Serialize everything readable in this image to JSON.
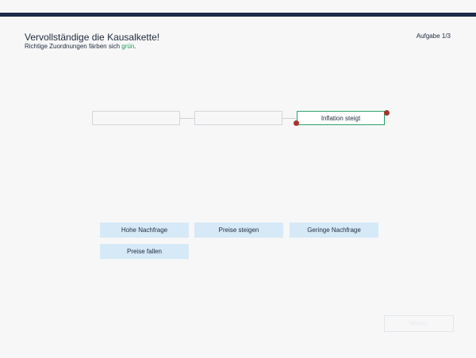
{
  "header": {
    "title": "Vervollständige die Kausalkette!",
    "subtitle_prefix": "Richtige Zuordnungen färben sich ",
    "subtitle_highlight": "grün",
    "subtitle_suffix": ".",
    "task_counter": "Aufgabe 1/3"
  },
  "chain": {
    "slots": [
      {
        "value": ""
      },
      {
        "value": ""
      },
      {
        "value": "Inflation steigt"
      }
    ]
  },
  "options": [
    {
      "label": "Hohe Nachfrage"
    },
    {
      "label": "Preise steigen"
    },
    {
      "label": "Geringe Nachfrage"
    },
    {
      "label": "Preise fallen"
    }
  ],
  "footer": {
    "next_label": "Weiter"
  },
  "colors": {
    "topbar": "#1c2b4a",
    "correct": "#2aa36b",
    "option_bg": "#d6e9f7",
    "dot": "#a93232"
  }
}
